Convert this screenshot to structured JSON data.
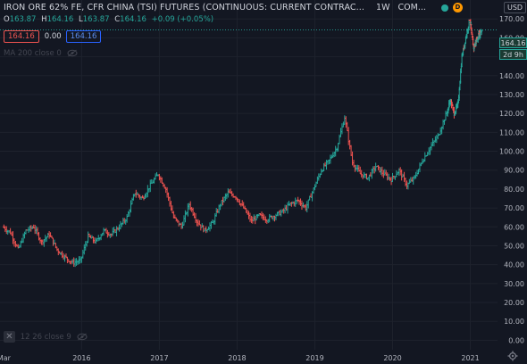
{
  "legend": {
    "title": "IRON ORE 62% FE, CFR CHINA (TSI) FUTURES (CONTINUOUS: CURRENT CONTRAC...",
    "interval": "1W",
    "exchange": "COM...",
    "badge": "D"
  },
  "ohlc": {
    "o_label": "O",
    "o_value": "163.87",
    "h_label": "H",
    "h_value": "164.16",
    "l_label": "L",
    "l_value": "163.87",
    "c_label": "C",
    "c_value": "164.16",
    "change": "+0.09 (+0.05%)"
  },
  "orders": {
    "sell": "164.16",
    "spread": "0.00",
    "buy": "164.16"
  },
  "indicators": {
    "ma": "MA 200 close 0",
    "macd": "12 26 close 9"
  },
  "currency": "USD",
  "last_price": "164.16",
  "countdown": "2d 9h",
  "colors": {
    "up": "#26a69a",
    "down": "#ef5350",
    "background": "#131722",
    "grid": "#1e222d"
  },
  "chart_data": {
    "type": "ohlc-bar",
    "yaxis": {
      "range": [
        -5,
        180
      ],
      "ticks": [
        0,
        10,
        20,
        30,
        40,
        50,
        60,
        70,
        80,
        90,
        100,
        110,
        120,
        130,
        140,
        150,
        160,
        170
      ],
      "tick_labels": [
        "0.00",
        "10.00",
        "20.00",
        "30.00",
        "40.00",
        "50.00",
        "60.00",
        "70.00",
        "80.00",
        "90.00",
        "100.00",
        "110.00",
        "120.00",
        "130.00",
        "140.00",
        "150.00",
        "160.00",
        "170.00"
      ]
    },
    "xaxis": {
      "range": [
        2014.95,
        2021.35
      ],
      "ticks": [
        2015.0,
        2016,
        2017,
        2018,
        2019,
        2020,
        2021
      ],
      "tick_labels": [
        "Mar",
        "2016",
        "2017",
        "2018",
        "2019",
        "2020",
        "2021"
      ]
    },
    "series": {
      "x": [
        2015.0,
        2015.1,
        2015.2,
        2015.3,
        2015.4,
        2015.5,
        2015.6,
        2015.7,
        2015.8,
        2015.9,
        2016.0,
        2016.1,
        2016.2,
        2016.3,
        2016.4,
        2016.5,
        2016.6,
        2016.7,
        2016.8,
        2016.9,
        2017.0,
        2017.1,
        2017.2,
        2017.3,
        2017.4,
        2017.5,
        2017.6,
        2017.7,
        2017.8,
        2017.9,
        2018.0,
        2018.1,
        2018.2,
        2018.3,
        2018.4,
        2018.5,
        2018.6,
        2018.7,
        2018.8,
        2018.9,
        2019.0,
        2019.1,
        2019.2,
        2019.3,
        2019.4,
        2019.5,
        2019.6,
        2019.7,
        2019.8,
        2019.9,
        2020.0,
        2020.1,
        2020.2,
        2020.3,
        2020.4,
        2020.5,
        2020.6,
        2020.7,
        2020.75,
        2020.8,
        2020.85,
        2020.9,
        2020.95,
        2021.0,
        2021.02,
        2021.05,
        2021.08,
        2021.12,
        2021.15
      ],
      "y": [
        60,
        57,
        48,
        58,
        60,
        52,
        56,
        48,
        44,
        41,
        42,
        55,
        52,
        58,
        56,
        60,
        65,
        78,
        75,
        82,
        88,
        80,
        65,
        60,
        72,
        63,
        58,
        62,
        72,
        78,
        76,
        70,
        63,
        66,
        64,
        66,
        68,
        72,
        74,
        70,
        80,
        90,
        95,
        102,
        118,
        94,
        88,
        86,
        92,
        88,
        85,
        90,
        82,
        86,
        95,
        102,
        108,
        119,
        127,
        120,
        125,
        150,
        160,
        170,
        162,
        155,
        158,
        162,
        164.16
      ]
    }
  }
}
